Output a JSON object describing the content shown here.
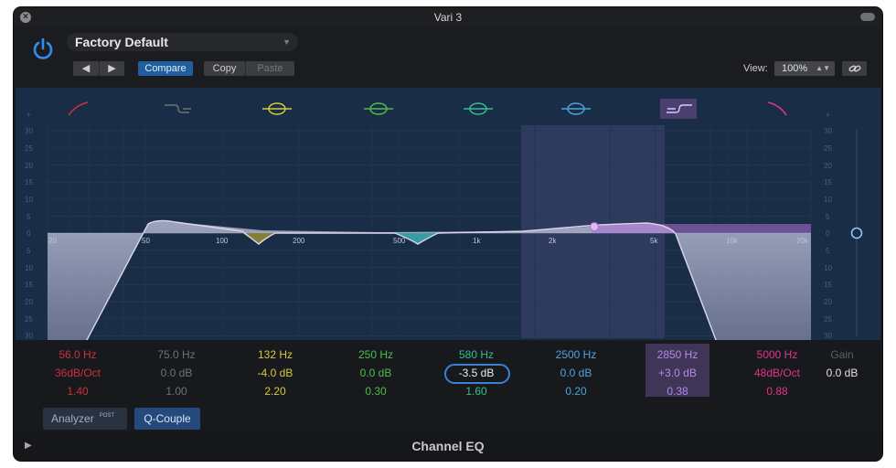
{
  "window": {
    "title": "Vari 3"
  },
  "header": {
    "preset": "Factory Default",
    "compare_label": "Compare",
    "copy_label": "Copy",
    "paste_label": "Paste",
    "prev_label": "◀",
    "next_label": "▶",
    "view_label": "View:",
    "zoom_value": "100%"
  },
  "graph": {
    "db_scale": [
      "+",
      "30",
      "25",
      "20",
      "15",
      "10",
      "5",
      "0",
      "5",
      "10",
      "15",
      "20",
      "25",
      "30",
      "-"
    ],
    "freq_labels": [
      "20",
      "50",
      "100",
      "200",
      "500",
      "1k",
      "2k",
      "5k",
      "10k",
      "20k"
    ],
    "gain_slider_db": 0.0
  },
  "bands": [
    {
      "freq": "56.0 Hz",
      "gain": "36dB/Oct",
      "q": "1.40",
      "color": "#c8323c",
      "active": true
    },
    {
      "freq": "75.0 Hz",
      "gain": "0.0 dB",
      "q": "1.00",
      "color": "#6f7275",
      "active": false
    },
    {
      "freq": "132 Hz",
      "gain": "-4.0 dB",
      "q": "2.20",
      "color": "#d4cc3a",
      "active": true
    },
    {
      "freq": "250 Hz",
      "gain": "0.0 dB",
      "q": "0.30",
      "color": "#4bbf4b",
      "active": true
    },
    {
      "freq": "580 Hz",
      "gain": "-3.5 dB",
      "q": "1.60",
      "color": "#35bf8e",
      "active": true
    },
    {
      "freq": "2500 Hz",
      "gain": "0.0 dB",
      "q": "0.20",
      "color": "#4ea3dd",
      "active": true
    },
    {
      "freq": "2850 Hz",
      "gain": "+3.0 dB",
      "q": "0.38",
      "color": "#b28ae6",
      "active": true
    },
    {
      "freq": "5000 Hz",
      "gain": "48dB/Oct",
      "q": "0.88",
      "color": "#e0358a",
      "active": true
    }
  ],
  "gain": {
    "label": "Gain",
    "value": "0.0 dB"
  },
  "bottom": {
    "analyzer_label": "Analyzer",
    "analyzer_post": "POST",
    "qcouple_label": "Q-Couple"
  },
  "footer": {
    "plugin_name": "Channel EQ"
  },
  "colors": {
    "accent": "#1f5f9d",
    "power": "#2e8ff0",
    "graph_bg": "#1a2d47"
  }
}
